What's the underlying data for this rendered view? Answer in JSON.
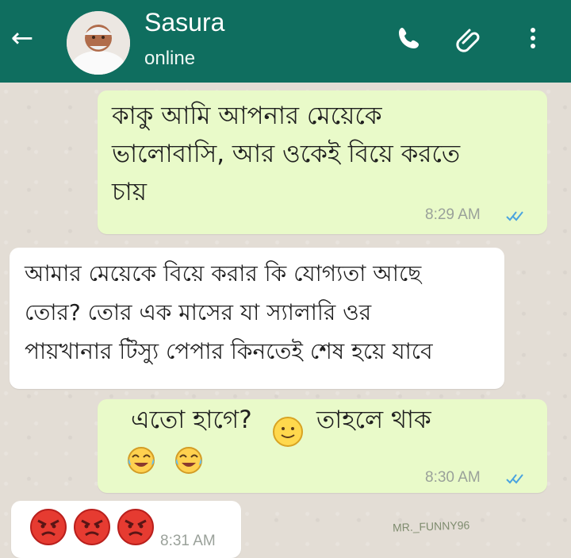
{
  "header": {
    "back_label": "←",
    "contact_name": "Sasura",
    "contact_status": "online",
    "colors": {
      "header": "#0f6e5f",
      "outgoing_bubble": "#e9fac9",
      "incoming_bubble": "#ffffff"
    },
    "icons": {
      "back": "arrow-left-icon",
      "avatar": "avatar-photo",
      "call": "phone-icon",
      "attach": "paperclip-icon",
      "menu": "more-vertical-icon"
    }
  },
  "messages": [
    {
      "direction": "outgoing",
      "text": "কাকু আমি আপনার মেয়েকে\nভালোবাসি, আর ওকেই বিয়ে করতে\nচায়",
      "time": "8:29 AM",
      "status_icon": "double-check-icon"
    },
    {
      "direction": "incoming",
      "text": "আমার মেয়েকে বিয়ে করার কি যোগ্যতা আছে\nতোর? তোর এক মাসের যা স্যালারি ওর\nপায়খানার টিস্যু পেপার কিনতেই শেষ হয়ে যাবে"
    },
    {
      "direction": "outgoing",
      "text": "এতো হাগে?",
      "text_after": "তাহলে থাক",
      "emojis": [
        "slight-smile-emoji",
        "tears-of-joy-emoji",
        "tears-of-joy-emoji"
      ],
      "time": "8:30 AM",
      "status_icon": "double-check-icon"
    },
    {
      "direction": "incoming",
      "emojis": [
        "angry-face-emoji",
        "angry-face-emoji",
        "angry-face-emoji"
      ],
      "time": "8:31 AM"
    }
  ],
  "watermark": "MR._FUNNY96"
}
